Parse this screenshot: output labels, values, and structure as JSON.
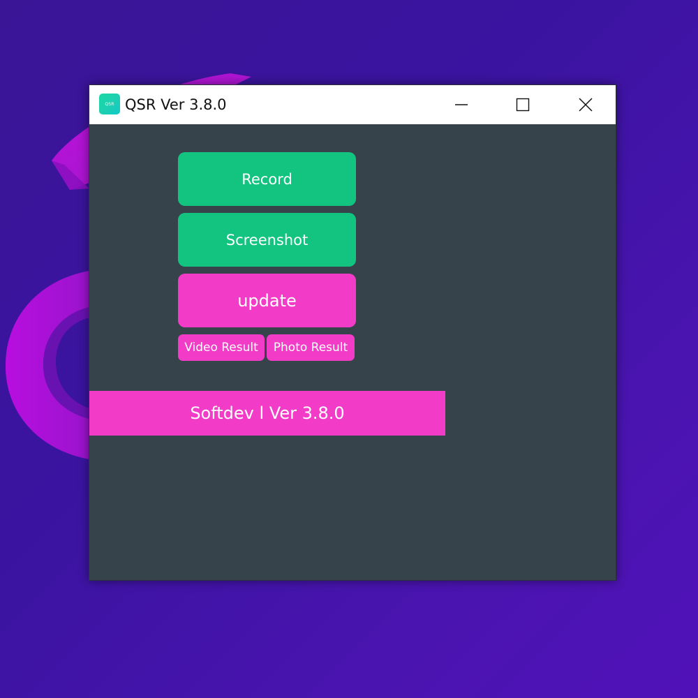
{
  "window": {
    "title": "QSR Ver 3.8.0",
    "icon_text": "QSR",
    "icon_name": "qsr-app-icon"
  },
  "titlebar_controls": {
    "minimize_icon": "minimize-icon",
    "maximize_icon": "maximize-icon",
    "close_icon": "close-icon"
  },
  "buttons": {
    "record": "Record",
    "screenshot": "Screenshot",
    "update": "update",
    "video_result": "Video Result",
    "photo_result": "Photo Result"
  },
  "footer": {
    "text": "Softdev l Ver 3.8.0"
  },
  "colors": {
    "desktop_background": "#3a1596",
    "window_background": "#37434a",
    "titlebar_background": "#ffffff",
    "green_button": "#12c47f",
    "pink_button": "#f23cc8",
    "wallpaper_shape": "#c40fd8"
  }
}
